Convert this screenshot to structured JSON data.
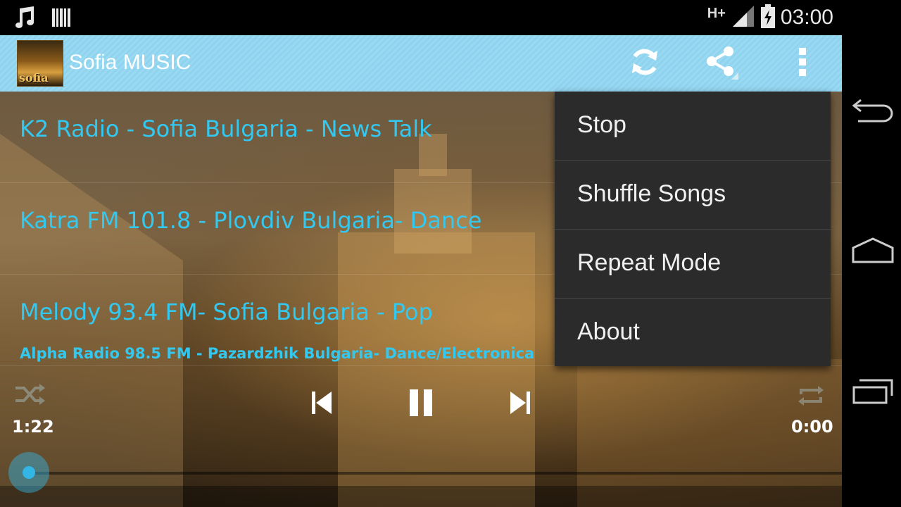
{
  "status_bar": {
    "network": "H+",
    "time": "03:00",
    "icons": [
      "music-note-icon",
      "barcode-icon",
      "signal-icon",
      "battery-charging-icon"
    ]
  },
  "app_bar": {
    "title": "Sofia MUSIC",
    "logo_text": "sofia",
    "actions": [
      "refresh-icon",
      "share-icon",
      "overflow-menu-icon"
    ]
  },
  "stations": [
    {
      "label": "K2 Radio  - Sofia Bulgaria  - News Talk"
    },
    {
      "label": "Katra FM 101.8 - Plovdiv Bulgaria- Dance"
    },
    {
      "label": "Melody 93.4 FM- Sofia Bulgaria  - Pop"
    }
  ],
  "player": {
    "now_playing": "Alpha Radio 98.5 FM  -  Pazardzhik Bulgaria-  Dance/Electronica",
    "elapsed": "1:22",
    "duration": "0:00"
  },
  "menu": {
    "items": [
      {
        "label": "Stop"
      },
      {
        "label": "Shuffle Songs"
      },
      {
        "label": "Repeat Mode"
      },
      {
        "label": "About"
      }
    ]
  },
  "colors": {
    "accent": "#33c8f0",
    "app_bar": "#8fd3ef",
    "menu_bg": "#2b2b2b"
  }
}
